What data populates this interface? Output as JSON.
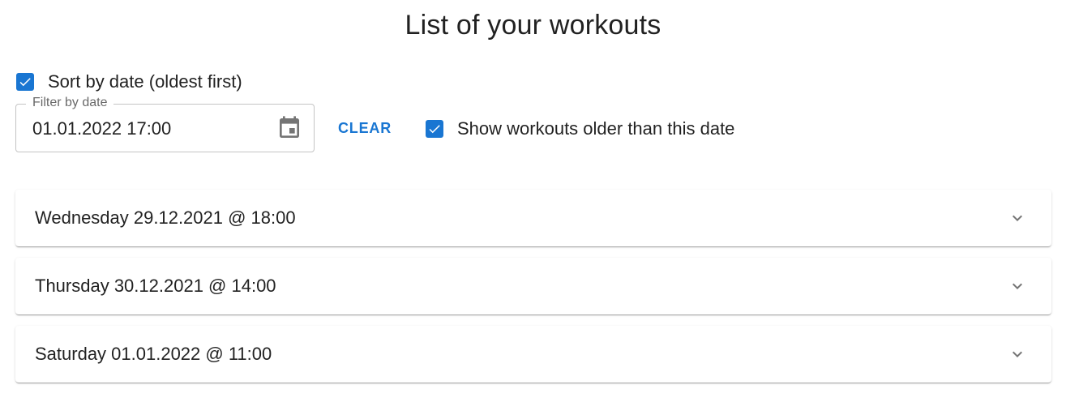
{
  "page": {
    "title": "List of your workouts"
  },
  "controls": {
    "sort_label": "Sort by date (oldest first)",
    "sort_checked": true,
    "filter_label": "Filter by date",
    "filter_value": "01.01.2022 17:00",
    "calendar_icon": "calendar-icon",
    "clear_label": "CLEAR",
    "older_label": "Show workouts older than this date",
    "older_checked": true
  },
  "workouts": [
    {
      "label": "Wednesday 29.12.2021 @ 18:00",
      "icon": "chevron-down-icon"
    },
    {
      "label": "Thursday 30.12.2021 @ 14:00",
      "icon": "chevron-down-icon"
    },
    {
      "label": "Saturday 01.01.2022 @ 11:00",
      "icon": "chevron-down-icon"
    }
  ],
  "colors": {
    "accent": "#1976d2",
    "border": "#c4c4c4",
    "icon": "#757575"
  }
}
